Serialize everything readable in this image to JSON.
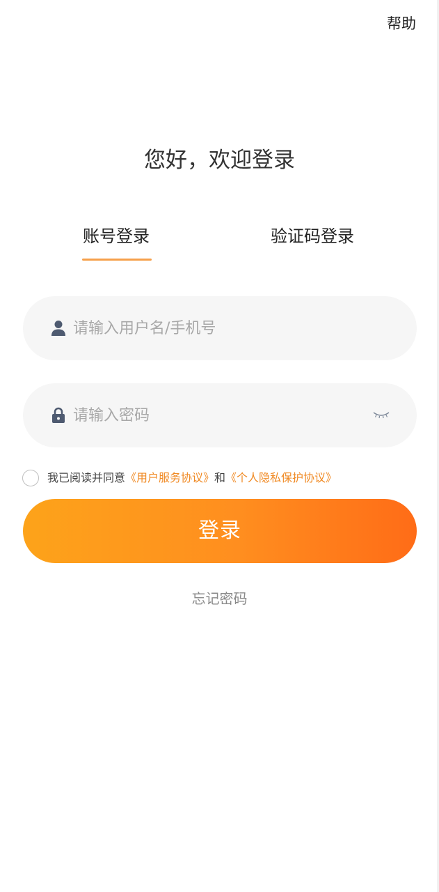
{
  "header": {
    "help_label": "帮助"
  },
  "greeting": "您好，欢迎登录",
  "tabs": [
    {
      "label": "账号登录",
      "active": true
    },
    {
      "label": "验证码登录",
      "active": false
    }
  ],
  "form": {
    "username": {
      "placeholder": "请输入用户名/手机号",
      "value": "",
      "icon": "user-icon"
    },
    "password": {
      "placeholder": "请输入密码",
      "value": "",
      "icon": "lock-icon",
      "toggle_icon": "eye-closed-icon"
    }
  },
  "agreement": {
    "checked": false,
    "prefix": "我已阅读并同意",
    "link_user": "《用户服务协议》",
    "conjunction": "和",
    "link_privacy": "《个人隐私保护协议》"
  },
  "login_button_label": "登录",
  "forgot_password_label": "忘记密码",
  "colors": {
    "accent": "#f08a24",
    "tab_underline": "#f6a04a",
    "button_gradient_start": "#fda31a",
    "button_gradient_end": "#ff6c17",
    "field_background": "#f6f6f6"
  }
}
